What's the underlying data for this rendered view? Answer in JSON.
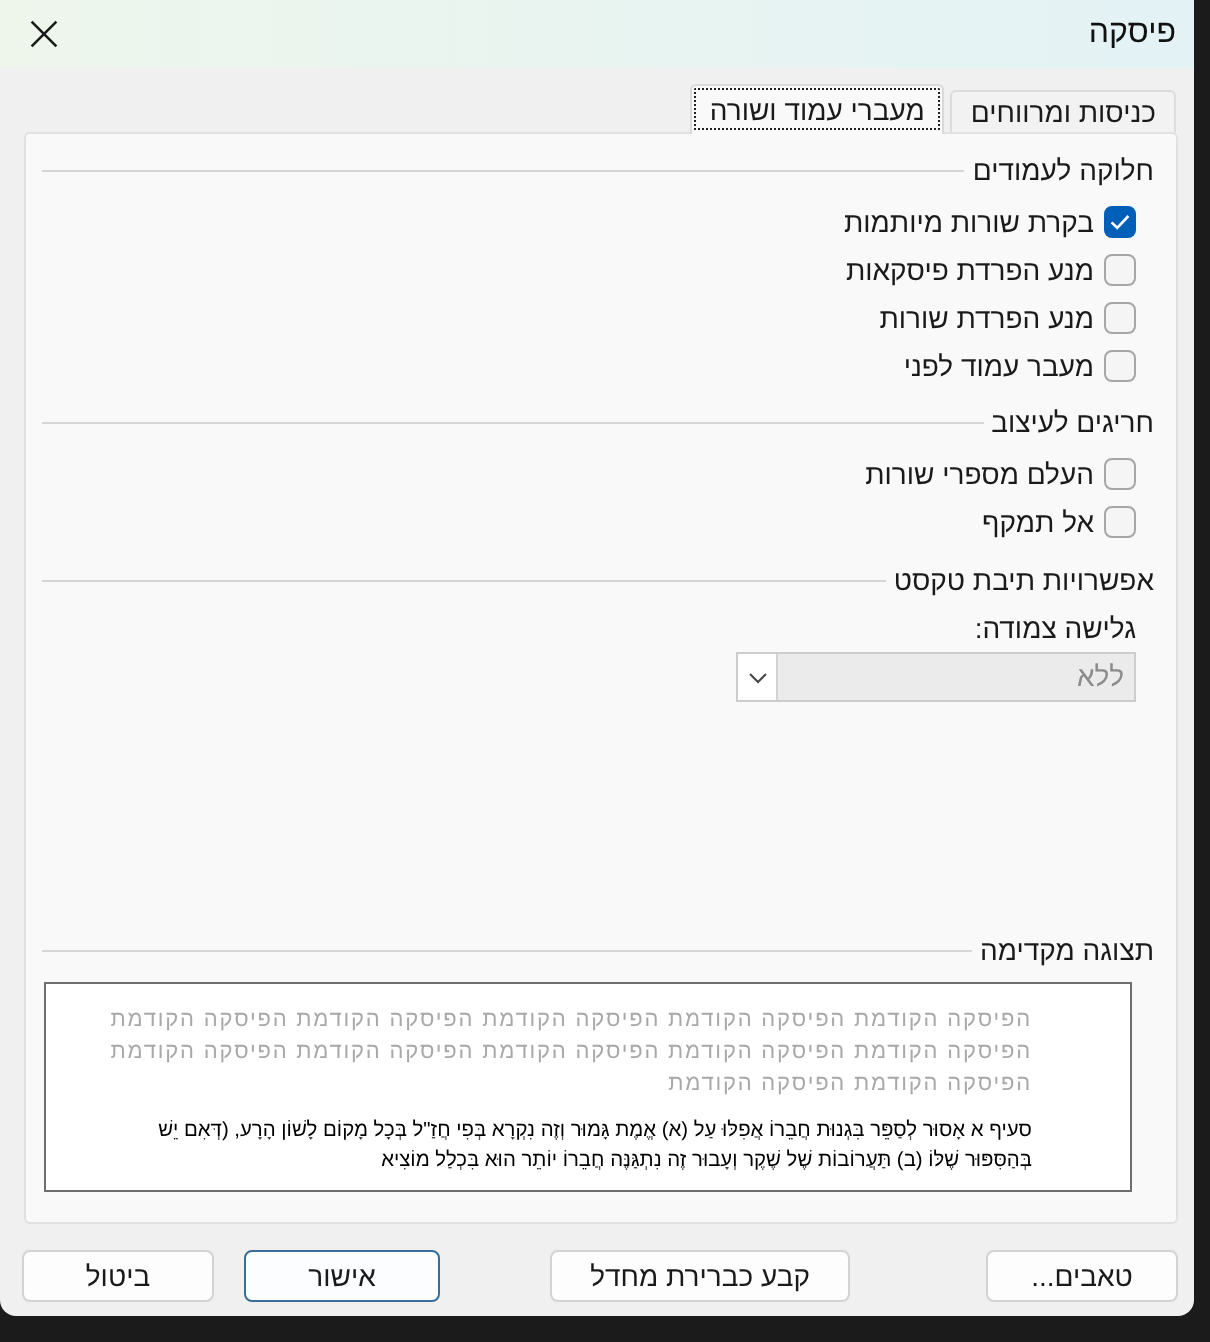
{
  "window": {
    "title": "פיסקה"
  },
  "tabs": [
    {
      "label": "כניסות ומרווחים",
      "selected": false,
      "focused": false
    },
    {
      "label": "מעברי עמוד ושורה",
      "selected": true,
      "focused": true
    }
  ],
  "pagination": {
    "title": "חלוקה לעמודים",
    "options": [
      {
        "label": "בקרת שורות מיותמות",
        "checked": true
      },
      {
        "label": "מנע הפרדת פיסקאות",
        "checked": false
      },
      {
        "label": "מנע הפרדת שורות",
        "checked": false
      },
      {
        "label": "מעבר עמוד לפני",
        "checked": false
      }
    ]
  },
  "formatting_exceptions": {
    "title": "חריגים לעיצוב",
    "options": [
      {
        "label": "העלם מספרי שורות",
        "checked": false
      },
      {
        "label": "אל תמקף",
        "checked": false
      }
    ]
  },
  "textbox_options": {
    "title": "אפשרויות תיבת טקסט",
    "tight_wrap": {
      "label": "גלישה צמודה:",
      "value": "ללא",
      "disabled": true
    }
  },
  "preview": {
    "title": "תצוגה מקדימה",
    "previous_paragraph": "הפיסקה הקודמת הפיסקה הקודמת הפיסקה הקודמת הפיסקה הקודמת הפיסקה הקודמת הפיסקה הקודמת הפיסקה הקודמת הפיסקה הקודמת הפיסקה הקודמת הפיסקה הקודמת הפיסקה הקודמת הפיסקה הקודמת",
    "sample_paragraph": "סעיף א אָסוּר לְסַפֵּר בִּגְנוּת חֲבֵרוֹ אֲפִלּוּ עַל (א) אֱמֶת גָּמוּר וְזֶה נִקְרָא בְּפִי חֲזַ\"ל בְּכָל מָקוֹם לָשׁוֹן הָרָע, (דְּאִם יֵשׁ בְּהַסִּפּוּר שֶׁלּוֹ (ב) תַּעֲרוֹבוֹת שֶׁל שֶׁקֶר וְעָבוּר זֶה נִתְגַּנֶּה חֲבֵרוֹ יוֹתֵר הוּא בִּכְלַל מוֹצִיא"
  },
  "buttons": [
    {
      "label": "טאבים...",
      "default": false
    },
    {
      "label": "קבע כברירת מחדל",
      "default": false
    },
    {
      "label": "אישור",
      "default": true
    },
    {
      "label": "ביטול",
      "default": false
    }
  ]
}
